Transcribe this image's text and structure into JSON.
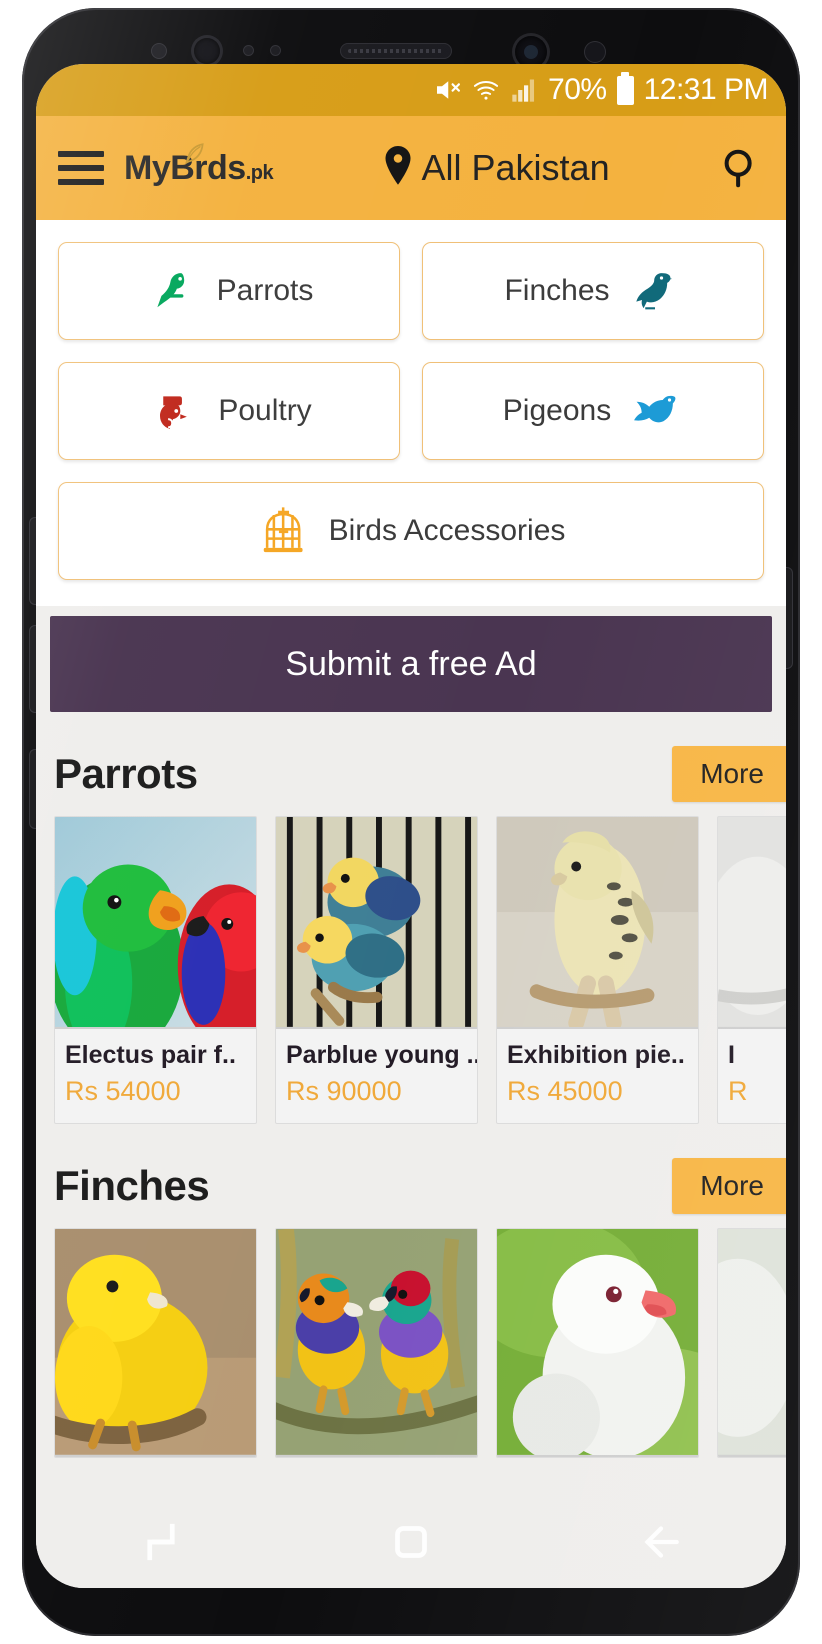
{
  "status_bar": {
    "mute_icon": "mute-icon",
    "wifi_icon": "wifi-icon",
    "signal_icon": "signal-icon",
    "battery_percent": "70%",
    "battery_icon": "battery-icon",
    "time": "12:31 PM"
  },
  "header": {
    "menu_icon": "hamburger-menu-icon",
    "brand_name": "MyB rds",
    "brand_prefix": "MyB",
    "brand_suffix": "rds",
    "brand_tld": ".pk",
    "feather_icon": "feather-icon",
    "location_icon": "location-pin-icon",
    "location": "All Pakistan",
    "search_icon": "search-icon"
  },
  "categories": [
    {
      "label": "Parrots",
      "icon": "parrot-icon",
      "color": "#00a65a",
      "icon_side": "left"
    },
    {
      "label": "Finches",
      "icon": "finch-icon",
      "color": "#10697a",
      "icon_side": "right"
    },
    {
      "label": "Poultry",
      "icon": "rooster-icon",
      "color": "#c0281c",
      "icon_side": "left"
    },
    {
      "label": "Pigeons",
      "icon": "pigeon-icon",
      "color": "#1b9ad6",
      "icon_side": "right"
    },
    {
      "label": "Birds Accessories",
      "icon": "birdcage-icon",
      "color": "#f5a623",
      "icon_side": "left"
    }
  ],
  "cta": {
    "label": "Submit a free Ad",
    "bg_color": "#4a3551"
  },
  "sections": [
    {
      "title": "Parrots",
      "more_label": "More",
      "items": [
        {
          "name": "Electus pair f..",
          "price": "Rs 54000",
          "art": "eclectus"
        },
        {
          "name": "Parblue young ..",
          "price": "Rs 90000",
          "art": "lovebirds"
        },
        {
          "name": "Exhibition pie..",
          "price": "Rs 45000",
          "art": "budgie"
        },
        {
          "name": "I",
          "price": "R",
          "art": "partial"
        }
      ]
    },
    {
      "title": "Finches",
      "more_label": "More",
      "items": [
        {
          "name": "",
          "price": "",
          "art": "canary"
        },
        {
          "name": "",
          "price": "",
          "art": "gouldian"
        },
        {
          "name": "",
          "price": "",
          "art": "javasparrow"
        },
        {
          "name": "",
          "price": "",
          "art": "partial2"
        }
      ]
    }
  ],
  "nav_bar": {
    "recents_icon": "recents-icon",
    "home_icon": "home-icon",
    "back_icon": "back-arrow-icon"
  },
  "theme": {
    "status_bar_bg": "#d79d17",
    "app_bar_bg": "#f4b23f",
    "accent": "#f8b747",
    "price_color": "#f0a93a",
    "card_border": "#f0c077"
  }
}
